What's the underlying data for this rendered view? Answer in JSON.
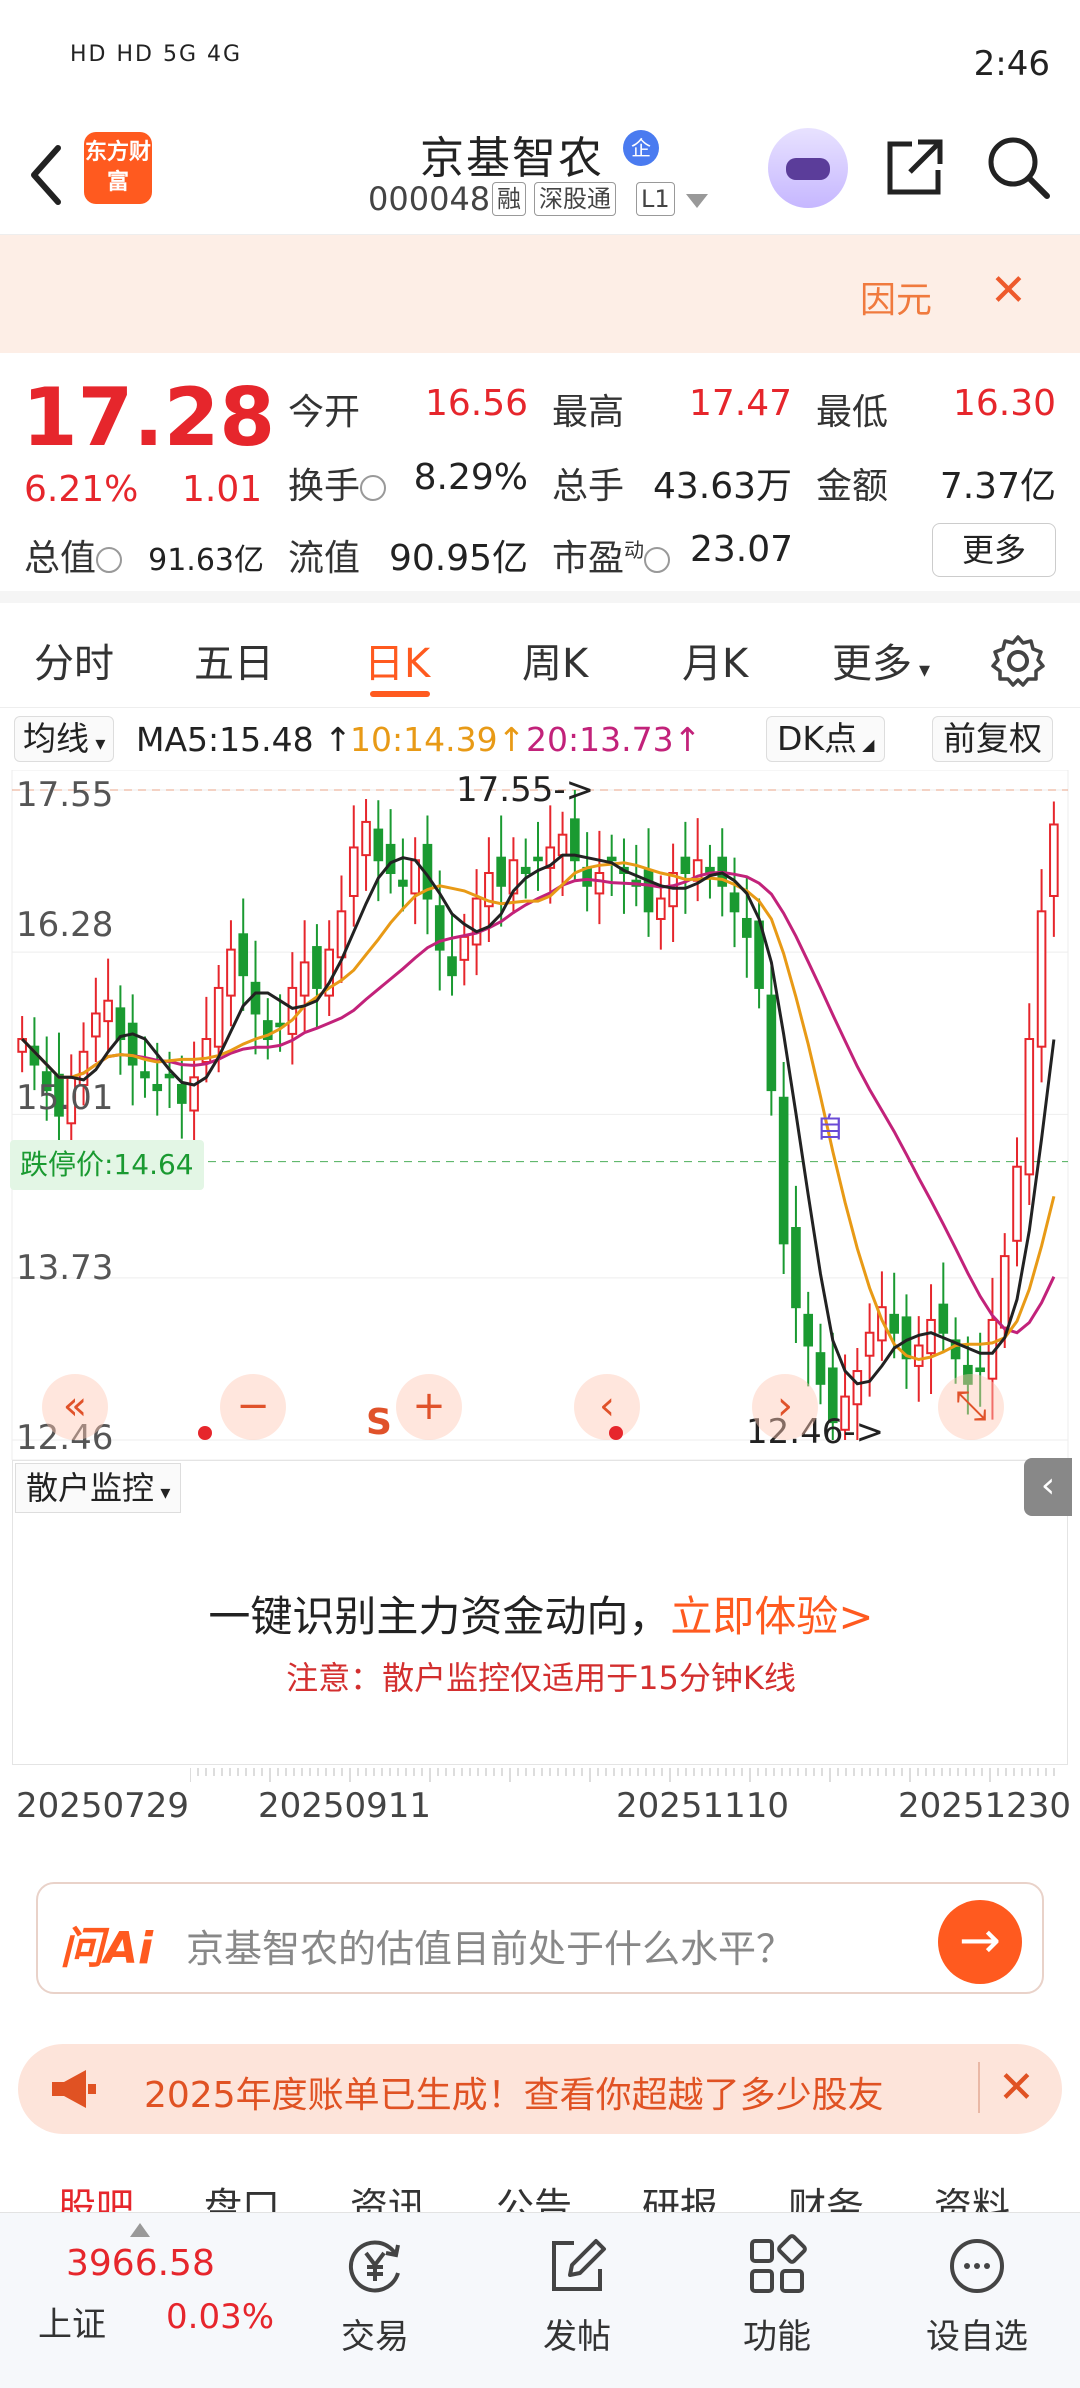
{
  "status_bar": {
    "left_text": "HD HD 5G 4G",
    "time": "2:46"
  },
  "header": {
    "logo_text": "东方财富",
    "stock_name": "京基智农",
    "qi_badge": "企",
    "stock_code": "000048",
    "tags": [
      "融",
      "深股通",
      "L1"
    ]
  },
  "banner": {
    "text": "因元",
    "close": "✕"
  },
  "quote": {
    "price": "17.28",
    "change_pct": "6.21%",
    "change": "1.01",
    "fields": [
      {
        "label": "今开",
        "value": "16.56",
        "color": "#e6262c"
      },
      {
        "label": "最高",
        "value": "17.47",
        "color": "#e6262c"
      },
      {
        "label": "最低",
        "value": "16.30",
        "color": "#e6262c"
      },
      {
        "label": "换手",
        "value": "8.29%",
        "color": "#222222"
      },
      {
        "label": "总手",
        "value": "43.63万",
        "color": "#222222"
      },
      {
        "label": "金额",
        "value": "7.37亿",
        "color": "#222222"
      },
      {
        "label": "总值",
        "value": "91.63亿",
        "color": "#222222"
      },
      {
        "label": "流值",
        "value": "90.95亿",
        "color": "#222222"
      },
      {
        "label": "市盈",
        "value": "23.07",
        "color": "#222222",
        "sup": "动"
      }
    ],
    "more": "更多"
  },
  "tabs": [
    "分时",
    "五日",
    "日K",
    "周K",
    "月K",
    "更多"
  ],
  "active_tab": "日K",
  "ma_bar": {
    "select": "均线",
    "ma5": "MA5:15.48",
    "ma10": "10:14.39",
    "ma20": "20:13.73",
    "dk": "DK点",
    "fq": "前复权",
    "colors": {
      "ma5": "#222222",
      "ma10": "#e89a16",
      "ma20": "#c2227a"
    }
  },
  "chart": {
    "y_labels": [
      "17.55",
      "16.28",
      "15.01",
      "13.73",
      "12.46"
    ],
    "limit_down": "跌停价:14.64",
    "high_marker": "17.55->",
    "low_marker": "12.46->",
    "s_marker": "S",
    "buy_marker": "自",
    "up_color": "#e6262c",
    "down_color": "#1a9a31"
  },
  "chart_data": {
    "type": "candlestick",
    "y_ticks": [
      17.55,
      16.28,
      15.01,
      13.73,
      12.46
    ],
    "x_ticks": [
      "20250729",
      "20250911",
      "20251110",
      "20251230"
    ],
    "closes": [
      15.6,
      15.4,
      15.2,
      15.0,
      15.3,
      15.5,
      15.8,
      15.9,
      15.6,
      15.4,
      15.3,
      15.2,
      15.3,
      15.1,
      15.3,
      15.6,
      16.0,
      16.3,
      16.1,
      15.8,
      15.6,
      15.7,
      16.0,
      16.2,
      16.0,
      16.3,
      16.6,
      17.1,
      17.3,
      17.0,
      16.9,
      16.8,
      17.0,
      16.7,
      16.3,
      16.1,
      16.4,
      16.7,
      16.9,
      16.8,
      17.0,
      16.9,
      17.0,
      17.1,
      17.2,
      17.0,
      16.8,
      16.9,
      17.0,
      16.9,
      16.8,
      16.6,
      16.7,
      16.9,
      16.9,
      17.0,
      16.9,
      16.8,
      16.6,
      16.4,
      16.0,
      15.2,
      14.0,
      13.5,
      13.2,
      12.9,
      12.6,
      12.8,
      13.0,
      13.3,
      13.5,
      13.3,
      13.1,
      13.2,
      13.4,
      13.3,
      13.1,
      12.9,
      13.0,
      13.4,
      13.9,
      14.6,
      15.6,
      16.6,
      17.28
    ],
    "ma5": "15.48",
    "ma10": "14.39",
    "ma20": "13.73"
  },
  "monitor": {
    "select": "散户监控",
    "headline": "一键识别主力资金动向，",
    "headline_link": "立即体验>",
    "note": "注意：散户监控仅适用于15分钟K线"
  },
  "dates": [
    "20250729",
    "20250911",
    "20251110",
    "20251230"
  ],
  "ai": {
    "logo": "问Ai",
    "placeholder": "京基智农的估值目前处于什么水平？"
  },
  "notice": {
    "text": "2025年度账单已生成！查看你超越了多少股友",
    "close": "✕"
  },
  "sub_tabs": [
    "股吧",
    "盘口",
    "资讯",
    "公告",
    "研报",
    "财务",
    "资料"
  ],
  "bottom": {
    "index_value": "3966.58",
    "index_name": "上证",
    "index_change": "0.03%",
    "nav": [
      {
        "label": "交易",
        "icon": "yen-cycle-icon"
      },
      {
        "label": "发帖",
        "icon": "edit-icon"
      },
      {
        "label": "功能",
        "icon": "grid-icon"
      },
      {
        "label": "设自选",
        "icon": "chat-dots-icon"
      }
    ]
  }
}
